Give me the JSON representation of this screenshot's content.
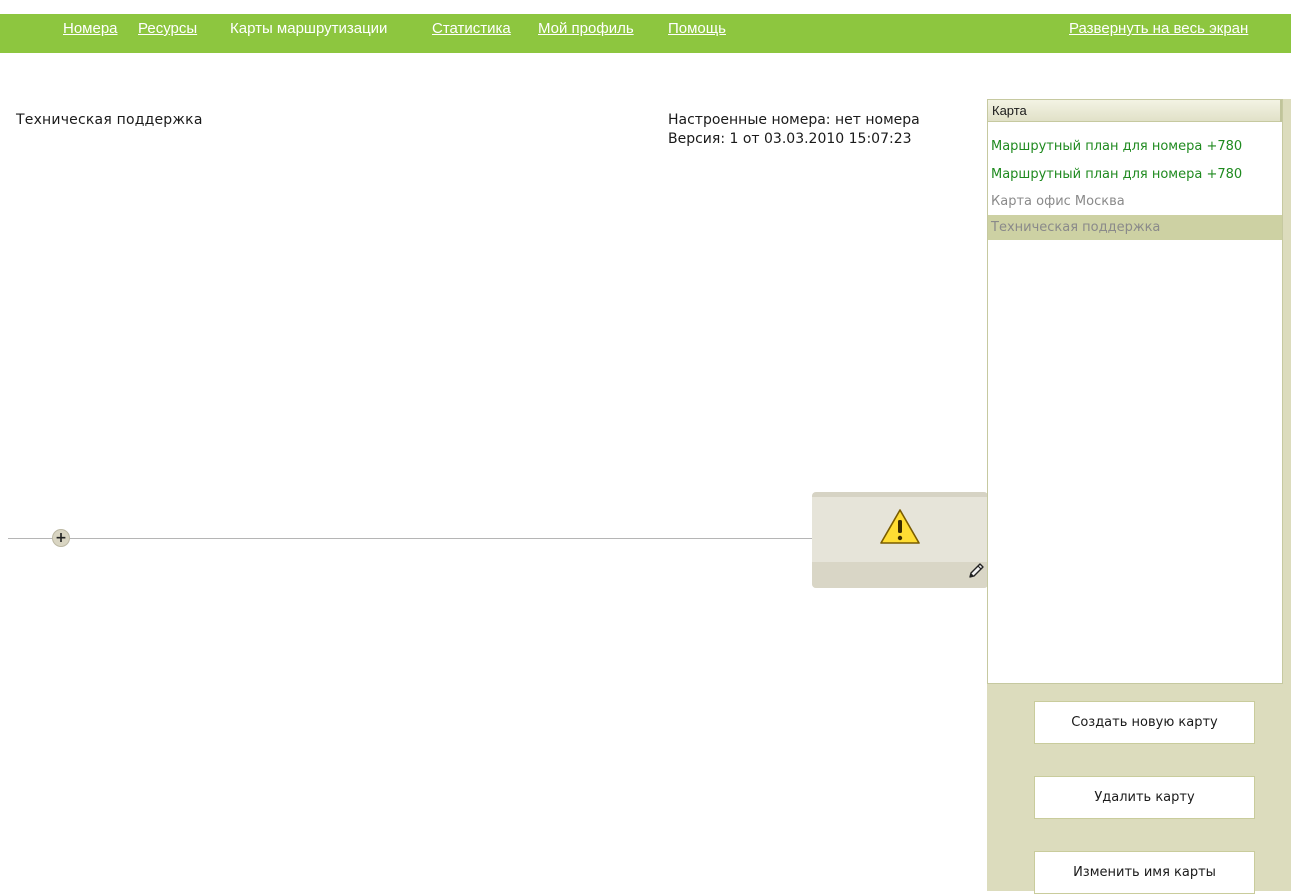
{
  "nav": {
    "links": [
      "Номера",
      "Ресурсы",
      "Карты маршрутизации",
      "Статистика",
      "Мой профиль",
      "Помощь"
    ],
    "fullscreen": "Развернуть на весь экран"
  },
  "map_title": "Техническая поддержка",
  "info": {
    "configured_numbers": "Настроенные номера: нет номера",
    "version": "Версия: 1 от 03.03.2010 15:07:23"
  },
  "diagram": {
    "add_symbol": "+"
  },
  "map_list": {
    "header": "Карта",
    "items": [
      {
        "label": "Маршрутный план для номера +780",
        "color": "#1f8a1f",
        "selected": false
      },
      {
        "label": "Маршрутный план для номера +780",
        "color": "#1f8a1f",
        "selected": false
      },
      {
        "label": "Карта офис Москва",
        "color": "#8a8a8a",
        "selected": false
      },
      {
        "label": "Техническая поддержка",
        "color": "#8a8a8a",
        "selected": true
      }
    ]
  },
  "buttons": {
    "create": "Создать новую карту",
    "delete": "Удалить карту",
    "rename": "Изменить имя карты"
  },
  "colors": {
    "topbar": "#8dc63f",
    "selected_row": "#cdd1a3",
    "panel": "#dcdcbd"
  }
}
